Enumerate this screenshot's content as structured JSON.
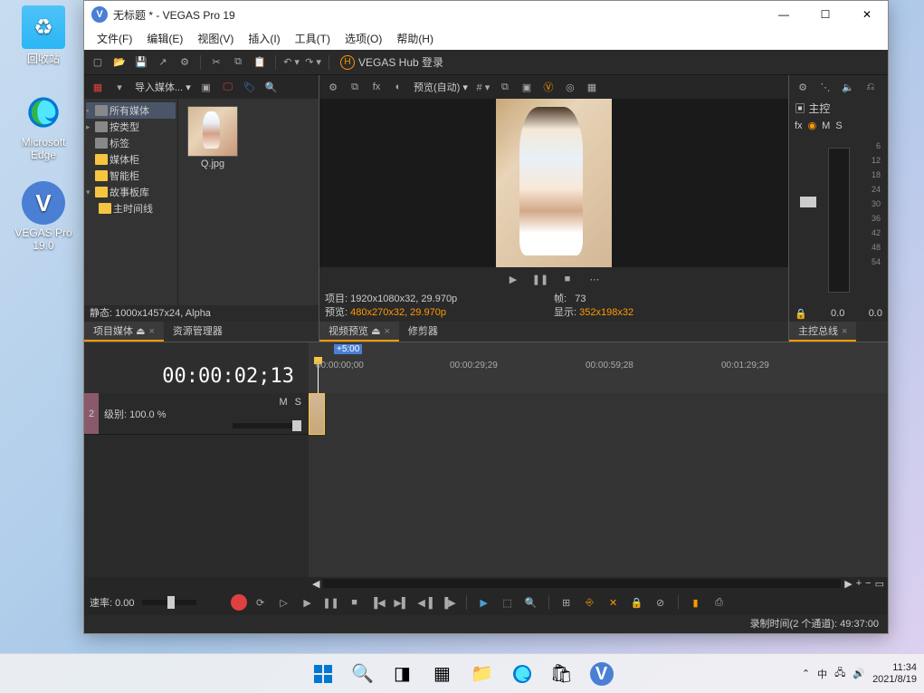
{
  "desktop": {
    "recycle": "回收站",
    "edge": "Microsoft Edge",
    "vegas": "VEGAS Pro 19.0"
  },
  "window": {
    "title": "无标题 * - VEGAS Pro 19"
  },
  "menu": {
    "file": "文件(F)",
    "edit": "编辑(E)",
    "view": "视图(V)",
    "insert": "插入(I)",
    "tools": "工具(T)",
    "options": "选项(O)",
    "help": "帮助(H)"
  },
  "toolbar": {
    "hub": "VEGAS Hub 登录"
  },
  "media": {
    "import": "导入媒体...",
    "tree": {
      "all": "所有媒体",
      "bytype": "按类型",
      "tags": "标签",
      "bins": "媒体柜",
      "smart": "智能柜",
      "story": "故事板库",
      "maintl": "主时间线"
    },
    "thumb": "Q.jpg",
    "status": "静态: 1000x1457x24, Alpha"
  },
  "tabs": {
    "projmedia": "项目媒体",
    "explorer": "资源管理器",
    "preview": "视频预览",
    "trimmer": "修剪器",
    "master": "主控总线"
  },
  "preview": {
    "mode": "预览(自动)",
    "project_lbl": "项目:",
    "project_val": "1920x1080x32, 29.970p",
    "preview_lbl": "预览:",
    "preview_val": "480x270x32, 29.970p",
    "frame_lbl": "帧:",
    "frame_val": "73",
    "display_lbl": "显示:",
    "display_val": "352x198x32"
  },
  "master": {
    "title": "主控",
    "fx": "fx",
    "m": "M",
    "s": "S",
    "scale": [
      "6",
      "12",
      "18",
      "24",
      "30",
      "36",
      "42",
      "48",
      "54"
    ],
    "val_l": "0.0",
    "val_r": "0.0"
  },
  "timeline": {
    "marker": "+5:00",
    "timecode": "00:00:02;13",
    "ruler": [
      "00:00:00;00",
      "00:00:29;29",
      "00:00:59;28",
      "00:01:29;29"
    ],
    "track_num": "2",
    "track_level": "级别: 100.0 %",
    "m": "M",
    "s": "S",
    "rate_lbl": "速率:",
    "rate_val": "0.00"
  },
  "statusbar": {
    "record": "录制时间(2 个通道): 49:37:00"
  },
  "taskbar": {
    "ime": "中",
    "time": "11:34",
    "date": "2021/8/19"
  }
}
